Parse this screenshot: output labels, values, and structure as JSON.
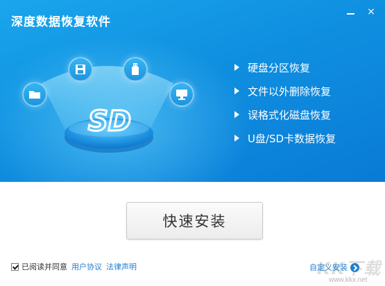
{
  "window": {
    "title": "深度数据恢复软件",
    "minimize_icon": "minimize-icon",
    "close_icon": "close-icon",
    "close_glyph": "×"
  },
  "hero": {
    "logo_text": "SD",
    "icons": [
      "folder-icon",
      "save-file-icon",
      "usb-drive-icon",
      "monitor-icon"
    ],
    "features": [
      "硬盘分区恢复",
      "文件以外删除恢复",
      "误格式化磁盘恢复",
      "U盘/SD卡数据恢复"
    ]
  },
  "install": {
    "quick_install_label": "快速安装",
    "custom_install_label": "自定义安装"
  },
  "agreement": {
    "checked": true,
    "label": "已阅读并同意",
    "user_agreement_link": "用户协议",
    "legal_link": "法律声明"
  },
  "watermark": {
    "text": "KK下载",
    "url": "www.kkx.net"
  },
  "colors": {
    "hero_blue": "#0f8fe0",
    "link_blue": "#1f7fd1",
    "button_bg": "#f2f2f2"
  }
}
